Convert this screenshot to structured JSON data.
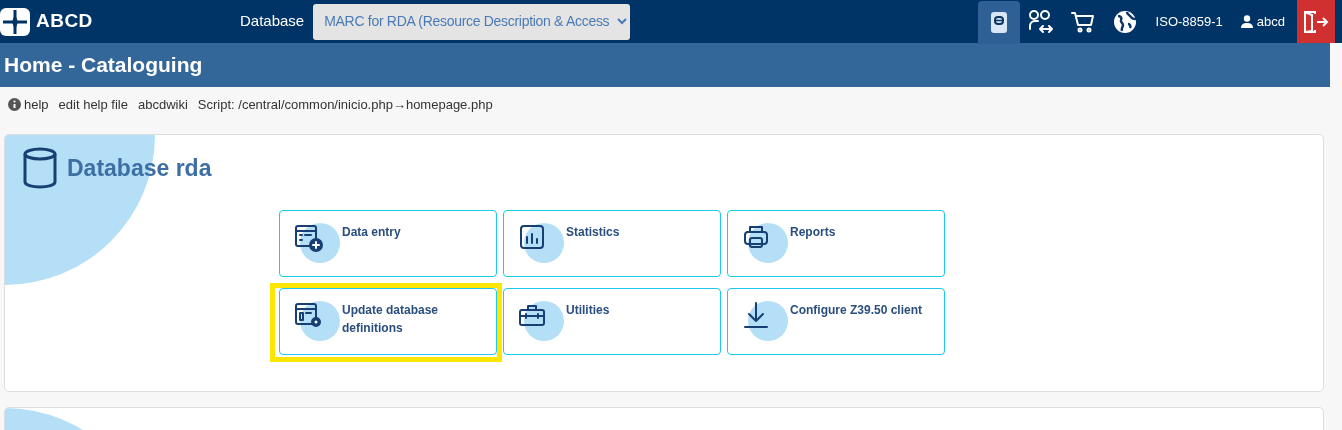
{
  "header": {
    "logo_text": "ABCD",
    "database_label": "Database",
    "database_select": "MARC for RDA (Resource Description & Access",
    "toolbar": [
      {
        "kind": "book",
        "selected": true
      },
      {
        "kind": "users",
        "selected": false
      },
      {
        "kind": "cart",
        "selected": false
      },
      {
        "kind": "globe",
        "selected": false
      }
    ],
    "charset": "ISO-8859-1",
    "user": "abcd"
  },
  "title": "Home - Cataloguing",
  "help_bar": {
    "help": "help",
    "edit_help": "edit help file",
    "wiki": "abcdwiki",
    "script": "Script: /central/common/inicio.php→homepage.php"
  },
  "section": {
    "title": "Database rda",
    "tiles": [
      {
        "kind": "data-entry",
        "label": "Data entry",
        "highlighted": false
      },
      {
        "kind": "statistics",
        "label": "Statistics",
        "highlighted": false
      },
      {
        "kind": "reports",
        "label": "Reports",
        "highlighted": false
      },
      {
        "kind": "definitions",
        "label": "Update database definitions",
        "highlighted": true
      },
      {
        "kind": "utilities",
        "label": "Utilities",
        "highlighted": false
      },
      {
        "kind": "download",
        "label": "Configure Z39.50 client",
        "highlighted": false
      }
    ]
  }
}
